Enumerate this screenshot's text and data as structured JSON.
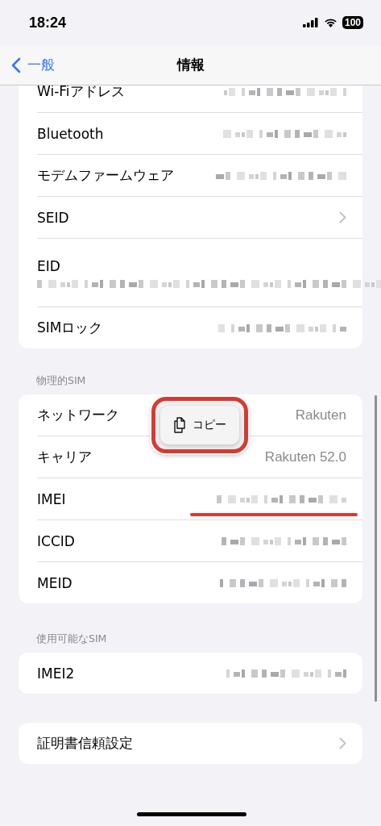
{
  "status_bar": {
    "time": "18:24",
    "battery": "100"
  },
  "nav": {
    "back": "一般",
    "title": "情報"
  },
  "groups": [
    {
      "rows": [
        {
          "label": "Wi-Fiアドレス",
          "kind": "redacted"
        },
        {
          "label": "Bluetooth",
          "kind": "redacted"
        },
        {
          "label": "モデムファームウェア",
          "kind": "redacted"
        },
        {
          "label": "SEID",
          "kind": "chevron"
        },
        {
          "label": "EID",
          "kind": "redacted_below"
        },
        {
          "label": "SIMロック",
          "kind": "redacted"
        }
      ]
    },
    {
      "header": "物理的SIM",
      "rows": [
        {
          "label": "ネットワーク",
          "kind": "text",
          "value": "Rakuten"
        },
        {
          "label": "キャリア",
          "kind": "text",
          "value": "Rakuten 52.0"
        },
        {
          "label": "IMEI",
          "kind": "redacted",
          "underlined": true
        },
        {
          "label": "ICCID",
          "kind": "redacted"
        },
        {
          "label": "MEID",
          "kind": "redacted"
        }
      ]
    },
    {
      "header": "使用可能なSIM",
      "rows": [
        {
          "label": "IMEI2",
          "kind": "redacted"
        }
      ]
    },
    {
      "rows": [
        {
          "label": "証明書信頼設定",
          "kind": "chevron"
        }
      ]
    }
  ],
  "popover": {
    "label": "コピー",
    "highlighted": true
  }
}
